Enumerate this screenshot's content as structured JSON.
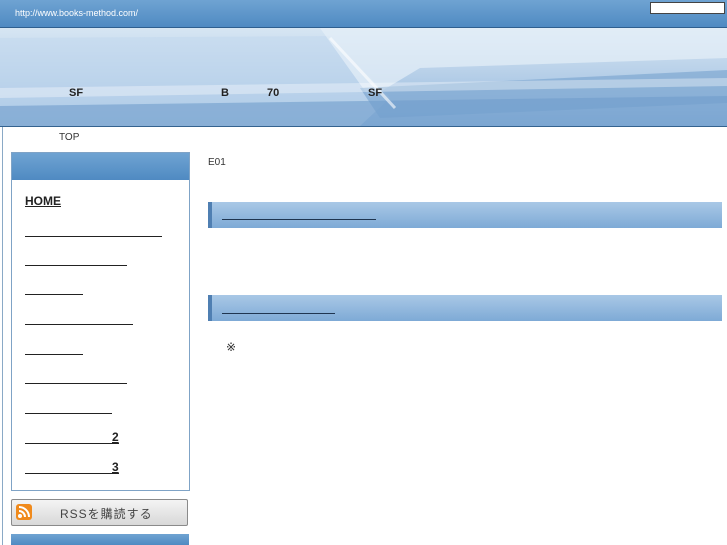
{
  "header": {
    "url": "http://www.books-method.com/"
  },
  "banner": {
    "words": [
      "SF",
      "B",
      "70",
      "SF"
    ]
  },
  "breadcrumb": {
    "top": "TOP"
  },
  "sidebar": {
    "home": "HOME",
    "num_2": "2",
    "num_3": "3",
    "rss": "RSSを購読する"
  },
  "main": {
    "code": "E01",
    "note": "※"
  },
  "colors": {
    "accent": "#5b95cc",
    "border": "#7fa3c6"
  }
}
